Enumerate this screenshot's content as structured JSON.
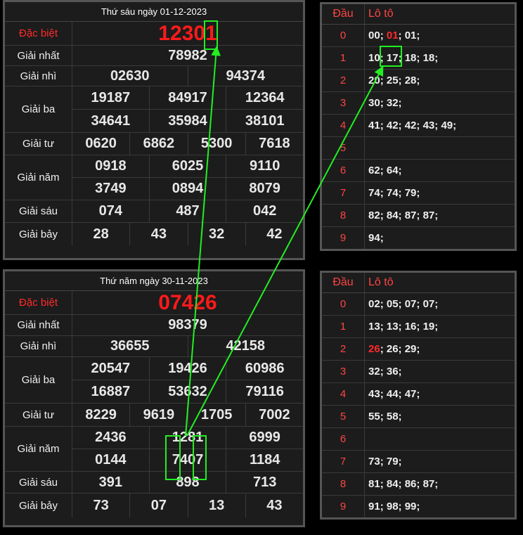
{
  "tables": [
    {
      "date_label": "Thứ sáu ngày 01-12-2023",
      "rows": [
        {
          "label": "Đặc biệt",
          "lines": [
            [
              "12301"
            ]
          ]
        },
        {
          "label": "Giải nhất",
          "lines": [
            [
              "78982"
            ]
          ]
        },
        {
          "label": "Giải nhì",
          "lines": [
            [
              "02630",
              "94374"
            ]
          ]
        },
        {
          "label": "Giải ba",
          "lines": [
            [
              "19187",
              "84917",
              "12364"
            ],
            [
              "34641",
              "35984",
              "38101"
            ]
          ]
        },
        {
          "label": "Giải tư",
          "lines": [
            [
              "0620",
              "6862",
              "5300",
              "7618"
            ]
          ]
        },
        {
          "label": "Giải năm",
          "lines": [
            [
              "0918",
              "6025",
              "9110"
            ],
            [
              "3749",
              "0894",
              "8079"
            ]
          ]
        },
        {
          "label": "Giải sáu",
          "lines": [
            [
              "074",
              "487",
              "042"
            ]
          ]
        },
        {
          "label": "Giải bảy",
          "lines": [
            [
              "28",
              "43",
              "32",
              "42"
            ]
          ]
        }
      ]
    },
    {
      "date_label": "Thứ năm ngày 30-11-2023",
      "rows": [
        {
          "label": "Đặc biệt",
          "lines": [
            [
              "07426"
            ]
          ]
        },
        {
          "label": "Giải nhất",
          "lines": [
            [
              "98379"
            ]
          ]
        },
        {
          "label": "Giải nhì",
          "lines": [
            [
              "36655",
              "42158"
            ]
          ]
        },
        {
          "label": "Giải ba",
          "lines": [
            [
              "20547",
              "19426",
              "60986"
            ],
            [
              "16887",
              "53632",
              "79116"
            ]
          ]
        },
        {
          "label": "Giải tư",
          "lines": [
            [
              "8229",
              "9619",
              "1705",
              "7002"
            ]
          ]
        },
        {
          "label": "Giải năm",
          "lines": [
            [
              "2436",
              "1281",
              "6999"
            ],
            [
              "0144",
              "7407",
              "1184"
            ]
          ]
        },
        {
          "label": "Giải sáu",
          "lines": [
            [
              "391",
              "898",
              "713"
            ]
          ]
        },
        {
          "label": "Giải bảy",
          "lines": [
            [
              "73",
              "07",
              "13",
              "43"
            ]
          ]
        }
      ]
    }
  ],
  "loto_tables": [
    {
      "header_dau": "Đầu",
      "header_loto": "Lô tô",
      "rows": [
        {
          "dau": "0",
          "values": [
            "00",
            "01",
            "01"
          ]
        },
        {
          "dau": "1",
          "values": [
            "10",
            "17",
            "18",
            "18"
          ]
        },
        {
          "dau": "2",
          "values": [
            "20",
            "25",
            "28"
          ]
        },
        {
          "dau": "3",
          "values": [
            "30",
            "32"
          ]
        },
        {
          "dau": "4",
          "values": [
            "41",
            "42",
            "42",
            "43",
            "49"
          ]
        },
        {
          "dau": "5",
          "values": []
        },
        {
          "dau": "6",
          "values": [
            "62",
            "64"
          ]
        },
        {
          "dau": "7",
          "values": [
            "74",
            "74",
            "79"
          ]
        },
        {
          "dau": "8",
          "values": [
            "82",
            "84",
            "87",
            "87"
          ]
        },
        {
          "dau": "9",
          "values": [
            "94"
          ]
        }
      ],
      "highlight": "01"
    },
    {
      "header_dau": "Đầu",
      "header_loto": "Lô tô",
      "rows": [
        {
          "dau": "0",
          "values": [
            "02",
            "05",
            "07",
            "07"
          ]
        },
        {
          "dau": "1",
          "values": [
            "13",
            "13",
            "16",
            "19"
          ]
        },
        {
          "dau": "2",
          "values": [
            "26",
            "26",
            "29"
          ]
        },
        {
          "dau": "3",
          "values": [
            "32",
            "36"
          ]
        },
        {
          "dau": "4",
          "values": [
            "43",
            "44",
            "47"
          ]
        },
        {
          "dau": "5",
          "values": [
            "55",
            "58"
          ]
        },
        {
          "dau": "6",
          "values": []
        },
        {
          "dau": "7",
          "values": [
            "73",
            "79"
          ]
        },
        {
          "dau": "8",
          "values": [
            "81",
            "84",
            "86",
            "87"
          ]
        },
        {
          "dau": "9",
          "values": [
            "91",
            "98",
            "99"
          ]
        }
      ],
      "highlight": "26"
    }
  ],
  "annotation_color": "#22ee22"
}
